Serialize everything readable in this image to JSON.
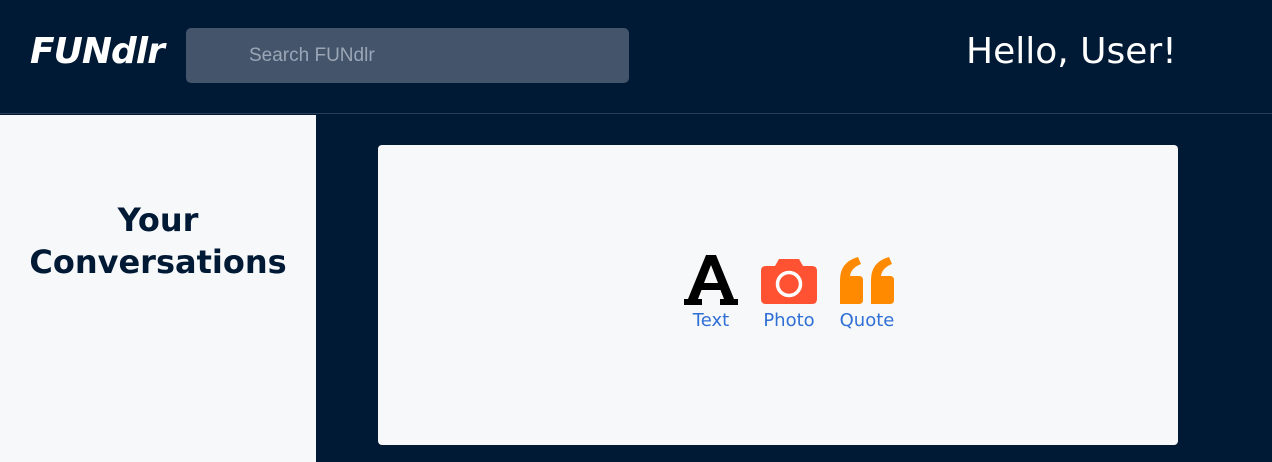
{
  "header": {
    "logo": "FUNdlr",
    "search_placeholder": "Search FUNdlr",
    "greeting": "Hello, User!"
  },
  "sidebar": {
    "title": "Your Conversations"
  },
  "post_types": [
    {
      "label": "Text",
      "icon": "text-icon",
      "color": "#000000"
    },
    {
      "label": "Photo",
      "icon": "camera-icon",
      "color": "#ff5233"
    },
    {
      "label": "Quote",
      "icon": "quote-icon",
      "color": "#ff8a00"
    }
  ],
  "colors": {
    "background": "#001935",
    "panel": "#f7f8fa",
    "search_bg": "#44546b",
    "link": "#2f6fd6"
  }
}
